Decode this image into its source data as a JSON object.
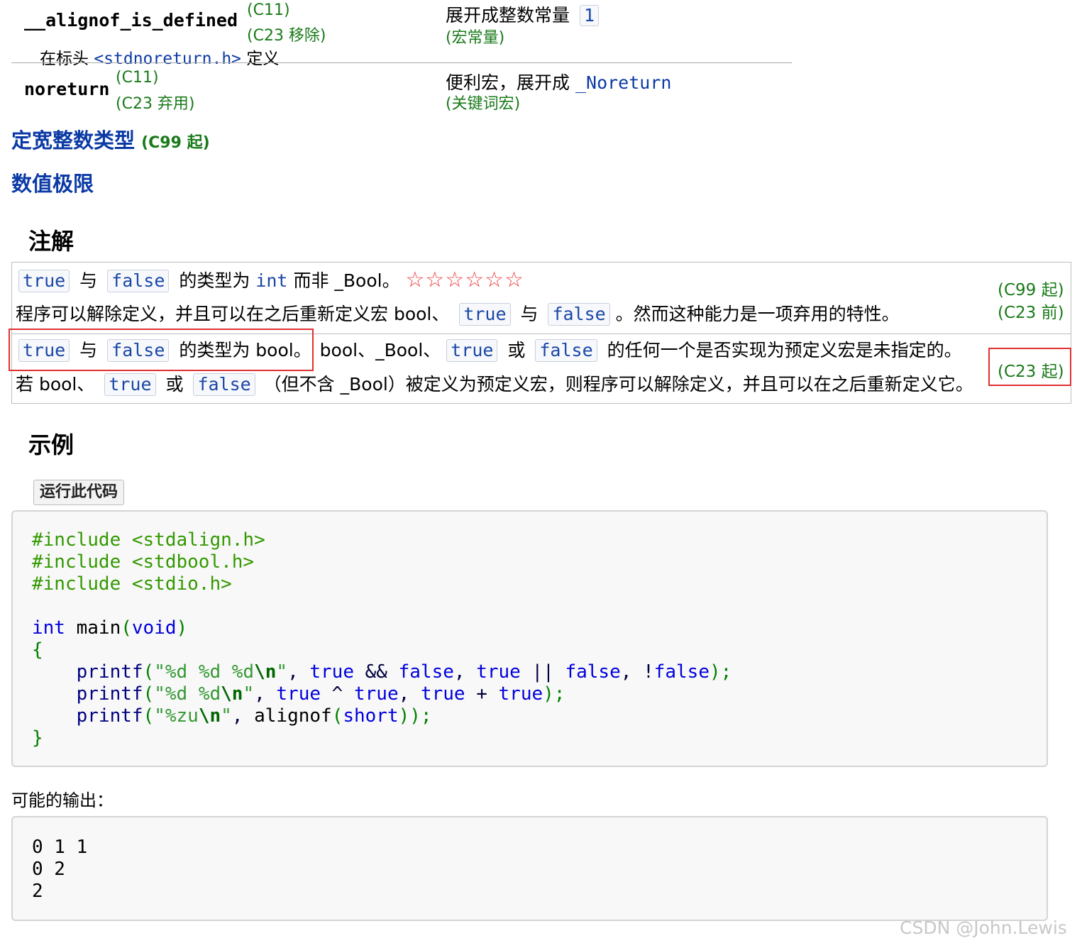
{
  "top_table": {
    "row1": {
      "name": "__alignof_is_defined",
      "rev1": "(C11)",
      "rev2": "(C23 移除)",
      "desc": "展开成整数常量",
      "desc_value": "1",
      "desc_kind": "(宏常量)"
    },
    "header_line": {
      "prefix": "在标头",
      "header": "<stdnoreturn.h>",
      "suffix": "定义"
    },
    "row2": {
      "name": "noreturn",
      "rev1": "(C11)",
      "rev2": "(C23 弃用)",
      "desc": "便利宏，展开成",
      "desc_link": "_Noreturn",
      "desc_kind": "(关键词宏)"
    }
  },
  "links": {
    "fixed_width": "定宽整数类型",
    "fixed_width_rev": "(C99 起)",
    "numeric_limits": "数值极限"
  },
  "notes": {
    "title": "注解",
    "row1": {
      "t1": "true",
      "t2": "与",
      "t3": "false",
      "t4": "的类型为",
      "t5": "int",
      "t6": "而非 _Bool。",
      "stars": "☆☆☆☆☆☆",
      "line2_a": "程序可以解除定义，并且可以在之后重新定义宏 bool、",
      "line2_b": "true",
      "line2_c": "与",
      "line2_d": "false",
      "line2_e": "。然而这种能力是一项弃用的特性。",
      "rev1": "(C99 起)",
      "rev2": "(C23 前)"
    },
    "row2": {
      "t1": "true",
      "t2": "与",
      "t3": "false",
      "t4": "的类型为 bool。",
      "t5": "bool、_Bool、",
      "t6": "true",
      "t7": "或",
      "t8": "false",
      "t9": "的任何一个是否实现为预定义宏是未指定的。",
      "line2_a": "若 bool、",
      "line2_b": "true",
      "line2_c": "或",
      "line2_d": "false",
      "line2_e": "（但不含 _Bool）被定义为预定义宏，则程序可以解除定义，并且可以在之后重新定义它。",
      "rev": "(C23 起)"
    }
  },
  "example": {
    "title": "示例",
    "run_button": "运行此代码",
    "code": {
      "inc1": "#include <stdalign.h>",
      "inc2": "#include <stdbool.h>",
      "inc3": "#include <stdio.h>",
      "int": "int",
      "main": " main",
      "paren_open": "(",
      "void": "void",
      "paren_close": ")",
      "brace_open": "{",
      "brace_close": "}",
      "printf": "printf",
      "l1_fmt": "\"%d %d %d",
      "l2_fmt": "\"%d %d",
      "l3_fmt": "\"%zu",
      "nl": "\\n",
      "quote": "\"",
      "true": "true",
      "false": "false",
      "short": "short",
      "alignof": " alignof",
      "and": " && ",
      "or": " || ",
      "not": "!",
      "xor": " ^ ",
      "plus": " + ",
      "comma": ", ",
      "close_semi": ");",
      "close2_semi": "));"
    },
    "output_label": "可能的输出：",
    "output_lines": [
      "0 1 1",
      "0 2",
      "2"
    ]
  },
  "watermark": "CSDN @John.Lewis"
}
